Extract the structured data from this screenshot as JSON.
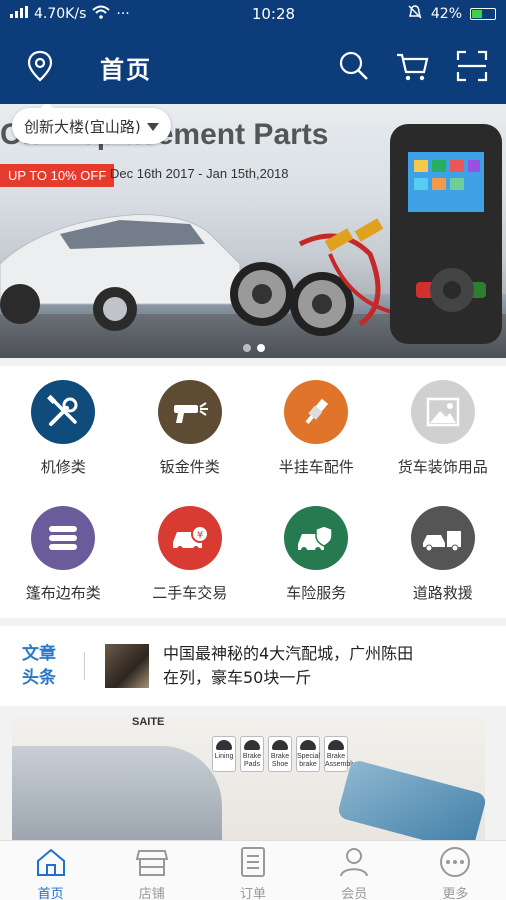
{
  "status_bar": {
    "net_speed": "4.70K/s",
    "time": "10:28",
    "battery": "42%",
    "battery_level": 0.42,
    "more": "···"
  },
  "header": {
    "title": "首页"
  },
  "location": {
    "label": "创新大楼(宜山路)"
  },
  "banner": {
    "title": "Car Replacement Parts",
    "promo": "UP TO 10% OFF",
    "dates": "Dec 16th 2017 - Jan 15th,2018",
    "slide_count": 2,
    "active_slide": 1
  },
  "categories": [
    {
      "label": "机修类",
      "icon": "wrench-screwdriver-icon",
      "color": "#0f4c7b"
    },
    {
      "label": "钣金件类",
      "icon": "spray-gun-icon",
      "color": "#5e4b33"
    },
    {
      "label": "半挂车配件",
      "icon": "spark-plug-icon",
      "color": "#e0742a"
    },
    {
      "label": "货车装饰用品",
      "icon": "image-icon",
      "color": "#d0d0d0"
    },
    {
      "label": "篷布边布类",
      "icon": "fabric-icon",
      "color": "#6a5b9b"
    },
    {
      "label": "二手车交易",
      "icon": "car-yuan-icon",
      "color": "#d83b31"
    },
    {
      "label": "车险服务",
      "icon": "car-shield-icon",
      "color": "#257a4f"
    },
    {
      "label": "道路救援",
      "icon": "tow-truck-icon",
      "color": "#555555"
    }
  ],
  "news": {
    "tag_line1": "文章",
    "tag_line2": "头条",
    "headline_line1": "中国最神秘的4大汽配城，广州陈田",
    "headline_line2": "在列，豪车50块一斤"
  },
  "ad": {
    "brand": "SAITE",
    "items": [
      "Lining",
      "Brake Pads",
      "Brake Shoe",
      "Special brake",
      "Brake Assembly"
    ]
  },
  "tabs": [
    {
      "label": "首页",
      "icon": "home-icon",
      "active": true
    },
    {
      "label": "店铺",
      "icon": "store-icon",
      "active": false
    },
    {
      "label": "订单",
      "icon": "order-icon",
      "active": false
    },
    {
      "label": "会员",
      "icon": "member-icon",
      "active": false
    },
    {
      "label": "更多",
      "icon": "more-icon",
      "active": false
    }
  ],
  "colors": {
    "brand_blue": "#0d3c7a",
    "tab_active": "#1f6fd1",
    "news_tag": "#2a78c8",
    "promo_red": "#e53b2c"
  }
}
